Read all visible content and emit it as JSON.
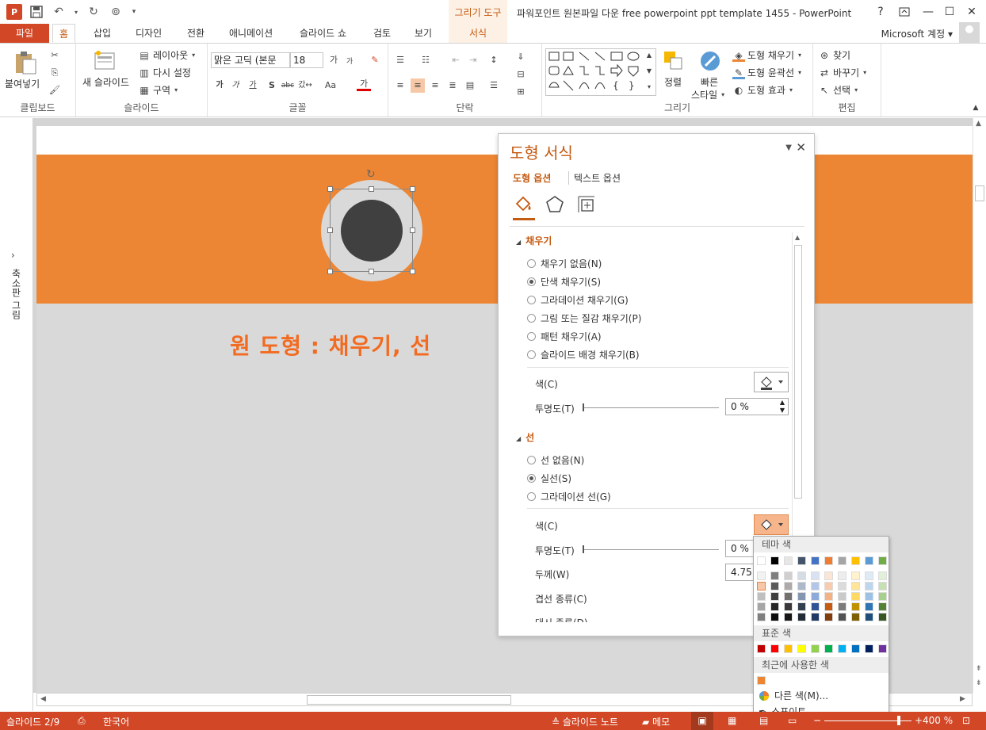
{
  "qat": {
    "icons": [
      "powerpoint-logo-icon",
      "save-icon",
      "undo-icon",
      "redo-icon",
      "slideshow-start-icon",
      "customize-qat-icon"
    ]
  },
  "window": {
    "title": "파워포인트 원본파일 다운 free powerpoint ppt template 1455 - PowerPoint",
    "context_tab_group": "그리기 도구",
    "help": "?",
    "account": "Microsoft 계정"
  },
  "tabs": {
    "file": "파일",
    "home": "홈",
    "insert": "삽입",
    "design": "디자인",
    "transitions": "전환",
    "animations": "애니메이션",
    "slideshow": "슬라이드 쇼",
    "review": "검토",
    "view": "보기",
    "format": "서식"
  },
  "ribbon": {
    "clipboard": {
      "label": "클립보드",
      "paste": "붙여넣기"
    },
    "slides": {
      "label": "슬라이드",
      "new_slide": "새 슬라이드",
      "layout": "레이아웃",
      "reset": "다시 설정",
      "section": "구역"
    },
    "font": {
      "label": "글꼴",
      "font_name": "맑은 고딕 (본문",
      "font_size": "18"
    },
    "paragraph": {
      "label": "단락"
    },
    "drawing": {
      "label": "그리기",
      "arrange": "정렬",
      "quick_styles_1": "빠른",
      "quick_styles_2": "스타일",
      "shape_fill": "도형 채우기",
      "shape_outline": "도형 윤곽선",
      "shape_effects": "도형 효과"
    },
    "editing": {
      "label": "편집",
      "find": "찾기",
      "replace": "바꾸기",
      "select": "선택"
    }
  },
  "thumb_pane": {
    "label": "축소판 그림"
  },
  "slide": {
    "heading": "원 도형 : 채우기, 선"
  },
  "format_pane": {
    "title": "도형 서식",
    "tab_shape": "도형 옵션",
    "tab_text": "텍스트 옵션",
    "fill": {
      "header": "채우기",
      "options": [
        {
          "label": "채우기 없음(N)",
          "selected": false
        },
        {
          "label": "단색 채우기(S)",
          "selected": true
        },
        {
          "label": "그라데이션 채우기(G)",
          "selected": false
        },
        {
          "label": "그림 또는 질감 채우기(P)",
          "selected": false
        },
        {
          "label": "패턴 채우기(A)",
          "selected": false
        },
        {
          "label": "슬라이드 배경 채우기(B)",
          "selected": false
        }
      ],
      "color_label": "색(C)",
      "transparency_label": "투명도(T)",
      "transparency_value": "0 %"
    },
    "line": {
      "header": "선",
      "options": [
        {
          "label": "선 없음(N)",
          "selected": false
        },
        {
          "label": "실선(S)",
          "selected": true
        },
        {
          "label": "그라데이션 선(G)",
          "selected": false
        }
      ],
      "color_label": "색(C)",
      "transparency_label": "투명도(T)",
      "transparency_value": "0 %",
      "width_label": "두께(W)",
      "width_value": "4.75",
      "compound_label": "겹선 종류(C)",
      "dash_label": "대시 종류(D)"
    }
  },
  "color_menu": {
    "theme_header": "테마 색",
    "standard_header": "표준 색",
    "recent_header": "최근에 사용한 색",
    "more_colors": "다른 색(M)...",
    "eyedropper": "스포이트",
    "theme_top": [
      "#ffffff",
      "#000000",
      "#e7e6e6",
      "#44546a",
      "#4472c4",
      "#ed7d31",
      "#a5a5a5",
      "#ffc000",
      "#5b9bd5",
      "#70ad47"
    ],
    "theme_shades": [
      [
        "#f2f2f2",
        "#7f7f7f",
        "#d0cece",
        "#d6dce4",
        "#d9e2f3",
        "#fbe5d5",
        "#ededed",
        "#fff2cc",
        "#deeaf6",
        "#e2efd9"
      ],
      [
        "#d8d8d8",
        "#595959",
        "#aeaaaa",
        "#adb9ca",
        "#b4c6e7",
        "#f7cbac",
        "#dbdbdb",
        "#fee599",
        "#bdd6ee",
        "#c5e0b3"
      ],
      [
        "#bfbfbf",
        "#3f3f3f",
        "#757070",
        "#8496b0",
        "#8eaadb",
        "#f4b183",
        "#c9c9c9",
        "#ffd965",
        "#9cc3e5",
        "#a8d08d"
      ],
      [
        "#a5a5a5",
        "#262626",
        "#3a3838",
        "#323f4f",
        "#2f5496",
        "#c55a11",
        "#7b7b7b",
        "#bf9000",
        "#2e75b5",
        "#538135"
      ],
      [
        "#7f7f7f",
        "#0c0c0c",
        "#171616",
        "#222a35",
        "#1f3864",
        "#833c0b",
        "#525252",
        "#7f6000",
        "#1e4e79",
        "#375623"
      ]
    ],
    "standard": [
      "#c00000",
      "#ff0000",
      "#ffc000",
      "#ffff00",
      "#92d050",
      "#00b050",
      "#00b0f0",
      "#0070c0",
      "#002060",
      "#7030a0"
    ],
    "recent": [
      "#ed8634"
    ]
  },
  "statusbar": {
    "slide_pos": "슬라이드 2/9",
    "language": "한국어",
    "notes": "슬라이드 노트",
    "comments": "메모",
    "zoom": "400 %"
  },
  "colors": {
    "accent": "#d24726",
    "orange": "#ed8634",
    "heading": "#f26b21"
  }
}
